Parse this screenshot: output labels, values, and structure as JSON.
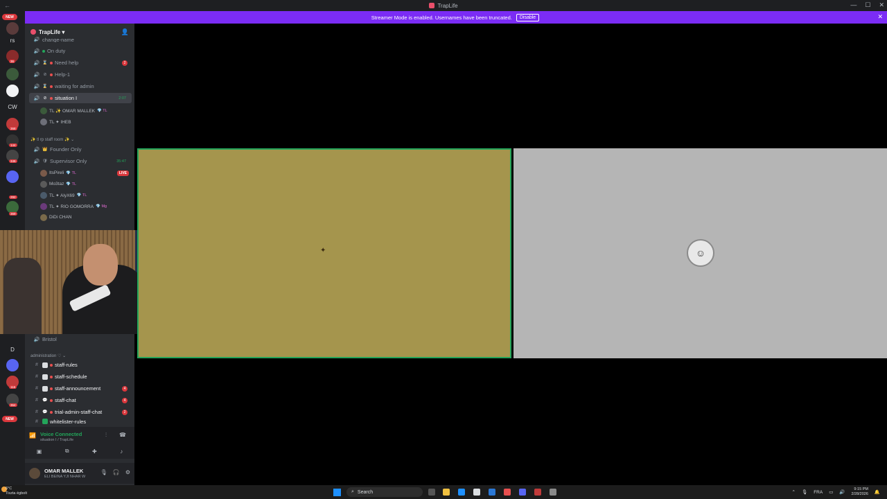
{
  "window": {
    "title": "TrapLife",
    "back_icon": "back-arrow-icon",
    "controls": [
      "—",
      "☐",
      "✕"
    ]
  },
  "banner": {
    "message": "Streamer Mode is enabled. Usernames have been truncated.",
    "action": "Disable",
    "close": "✕",
    "color": "#7b2cf5"
  },
  "rail": {
    "new_top": "NEW",
    "labels": [
      "rs",
      "CW",
      "D"
    ],
    "badges": [
      "36",
      "368",
      "144",
      "346",
      "292",
      "369",
      "116",
      "364"
    ],
    "new_bottom": "NEW"
  },
  "server": {
    "name": "TrapLife ▾",
    "add_icon": "add-member-icon"
  },
  "channels": [
    {
      "name": "change-name",
      "icon": "🔊"
    },
    {
      "name": "On duty",
      "icon": "🔊"
    },
    {
      "name": "Need help",
      "icon": "🔊",
      "count": "2"
    },
    {
      "name": "Help-1",
      "icon": "🔊"
    },
    {
      "name": "waiting for admin",
      "icon": "🔊"
    },
    {
      "name": "situation I",
      "icon": "🔊",
      "time": "2:07"
    }
  ],
  "voice_members_1": [
    {
      "name": "TL ✨ OMAR MALLEK",
      "tag": "💎 TL"
    },
    {
      "name": "TL ✦ IHEB",
      "tag": ""
    }
  ],
  "staff_category": "✨ tl rp staff room ✨ ⌄",
  "staff_channels": [
    {
      "name": "Founder Only",
      "icon": "🔊"
    },
    {
      "name": "Supervisor Only",
      "icon": "🔊",
      "time": "35:47"
    }
  ],
  "voice_members_2": [
    {
      "name": "ItsPireli",
      "tag": "💎 TL",
      "live": "LIVE"
    },
    {
      "name": "Mo3taz",
      "tag": "💎 TL"
    },
    {
      "name": "TL ✦ AlyX69",
      "tag": "💎 TL"
    },
    {
      "name": "TL ✦ RIO GOMORRA",
      "tag": "💎 Mg"
    },
    {
      "name": "DiDi CHAN",
      "tag": ""
    }
  ],
  "bristol": "Bristol",
  "admin_category": "administration ♡ ⌄",
  "text_channels": [
    {
      "name": "staff-rules",
      "count": ""
    },
    {
      "name": "staff-schedule",
      "count": ""
    },
    {
      "name": "staff-announcement",
      "count": "4"
    },
    {
      "name": "staff-chat",
      "count": "4"
    },
    {
      "name": "trial-admin-staff-chat",
      "count": "2"
    },
    {
      "name": "whitelister-rules",
      "count": ""
    }
  ],
  "voice_panel": {
    "status": "Voice Connected",
    "location": "situation I / TrapLife"
  },
  "user_panel": {
    "name": "OMAR MALLEK",
    "status": "ELI BEINA YJI NHAR W"
  },
  "taskbar": {
    "weather_temp": "6°C",
    "weather_desc": "Tiszta égbolt",
    "search": "Search",
    "lang": "FRA",
    "time": "9:15 PM",
    "date": "2/28/2026"
  },
  "colors": {
    "accent": "#7b2cf5",
    "online": "#23a55a",
    "alert": "#da373c",
    "tile_left": "#a5954d",
    "tile_right": "#b5b5b5"
  }
}
